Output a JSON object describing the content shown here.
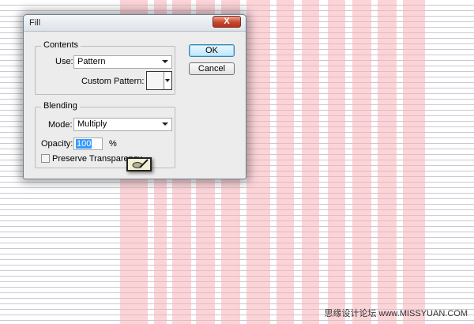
{
  "dialog": {
    "title": "Fill",
    "close_label": "X",
    "ok_label": "OK",
    "cancel_label": "Cancel",
    "contents": {
      "legend": "Contents",
      "use_label": "Use:",
      "use_value": "Pattern",
      "custom_pattern_label": "Custom Pattern:"
    },
    "blending": {
      "legend": "Blending",
      "mode_label": "Mode:",
      "mode_value": "Multiply",
      "opacity_label": "Opacity:",
      "opacity_value": "100",
      "opacity_unit": "%",
      "preserve_transparency_label": "Preserve Transparency",
      "preserve_transparency_checked": false
    }
  },
  "cursor": {
    "icon": "pencil-cursor-icon"
  },
  "background": {
    "stripe_color": "#f6b7bd",
    "line_color": "#c9c9d2"
  },
  "watermark": "思缘设计论坛 www.MISSYUAN.COM",
  "colors": {
    "close_button": "#c8482f",
    "selection": "#3399ff",
    "default_button_border": "#3c7fb1"
  }
}
